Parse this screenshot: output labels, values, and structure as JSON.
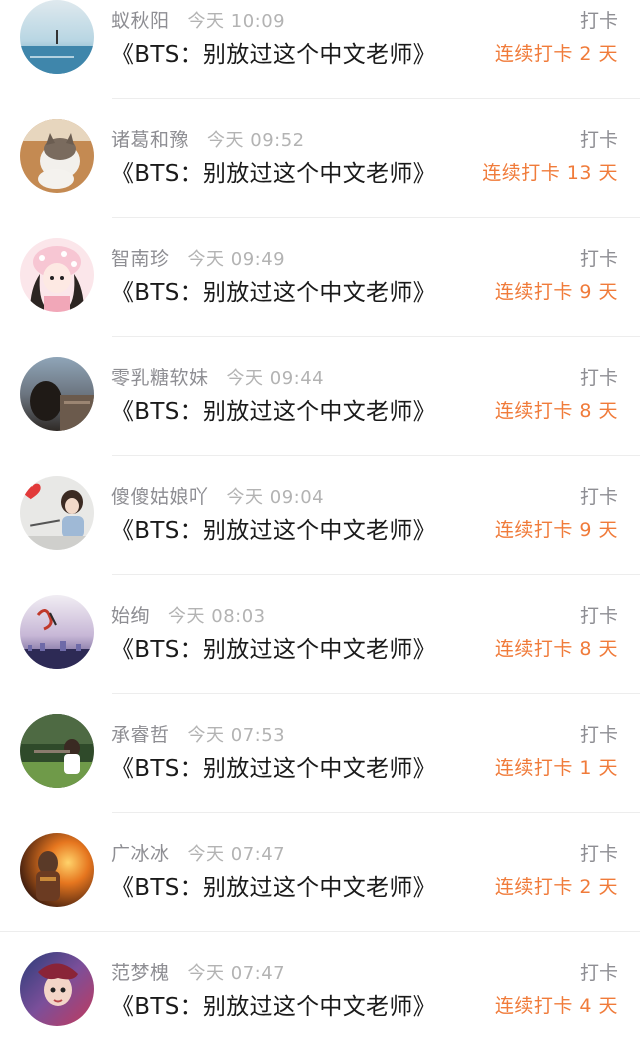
{
  "checkins": [
    {
      "name": "蚁秋阳",
      "time": "今天 10:09",
      "title": "《BTS：别放过这个中文老师》",
      "action": "打卡",
      "streak": "连续打卡 2 天",
      "avatar_icon": "seascape-avatar-icon"
    },
    {
      "name": "诸葛和豫",
      "time": "今天 09:52",
      "title": "《BTS：别放过这个中文老师》",
      "action": "打卡",
      "streak": "连续打卡 13 天",
      "avatar_icon": "cat-avatar-icon"
    },
    {
      "name": "智南珍",
      "time": "今天 09:49",
      "title": "《BTS：别放过这个中文老师》",
      "action": "打卡",
      "streak": "连续打卡 9 天",
      "avatar_icon": "cartoon-girl-avatar-icon"
    },
    {
      "name": "零乳糖软妹",
      "time": "今天 09:44",
      "title": "《BTS：别放过这个中文老师》",
      "action": "打卡",
      "streak": "连续打卡 8 天",
      "avatar_icon": "person-photo-avatar-icon"
    },
    {
      "name": "傻傻姑娘吖",
      "time": "今天 09:04",
      "title": "《BTS：别放过这个中文老师》",
      "action": "打卡",
      "streak": "连续打卡 9 天",
      "avatar_icon": "heart-girl-avatar-icon"
    },
    {
      "name": "始绚",
      "time": "今天 08:03",
      "title": "《BTS：别放过这个中文老师》",
      "action": "打卡",
      "streak": "连续打卡 8 天",
      "avatar_icon": "city-night-avatar-icon"
    },
    {
      "name": "承睿哲",
      "time": "今天 07:53",
      "title": "《BTS：别放过这个中文老师》",
      "action": "打卡",
      "streak": "连续打卡 1 天",
      "avatar_icon": "outdoor-person-avatar-icon"
    },
    {
      "name": "广冰冰",
      "time": "今天 07:47",
      "title": "《BTS：别放过这个中文老师》",
      "action": "打卡",
      "streak": "连续打卡 2 天",
      "avatar_icon": "game-hero-avatar-icon"
    },
    {
      "name": "范梦槐",
      "time": "今天 07:47",
      "title": "《BTS：别放过这个中文老师》",
      "action": "打卡",
      "streak": "连续打卡 4 天",
      "avatar_icon": "game-character-avatar-icon"
    }
  ],
  "colors": {
    "name": "#8e8e93",
    "time": "#b3b3b3",
    "title": "#1a1a1a",
    "streak": "#f07b3a",
    "divider": "#ededed"
  }
}
